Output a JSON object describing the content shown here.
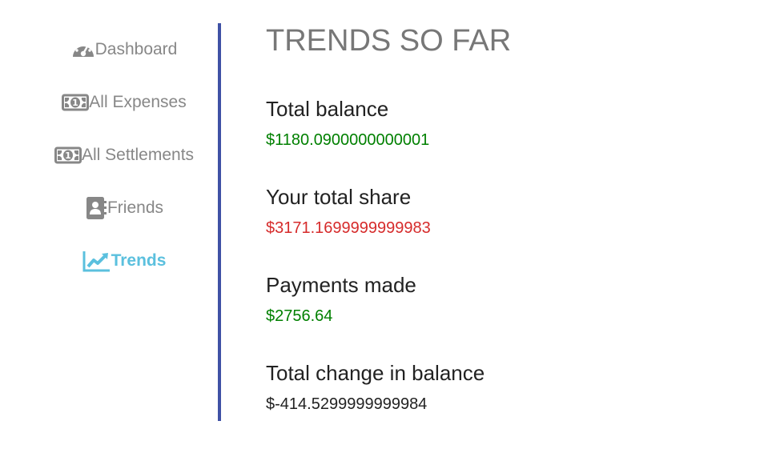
{
  "sidebar": {
    "items": [
      {
        "label": "Dashboard",
        "icon": "dashboard-icon"
      },
      {
        "label": "All Expenses",
        "icon": "money-bill-icon"
      },
      {
        "label": "All Settlements",
        "icon": "money-bill-icon"
      },
      {
        "label": "Friends",
        "icon": "address-book-icon"
      },
      {
        "label": "Trends",
        "icon": "chart-line-icon",
        "active": true
      }
    ]
  },
  "main": {
    "title": "TRENDS SO FAR",
    "stats": [
      {
        "label": "Total balance",
        "value": "$1180.0900000000001",
        "color": "#008000"
      },
      {
        "label": "Your total share",
        "value": "$3171.1699999999983",
        "color": "#d62b2b"
      },
      {
        "label": "Payments made",
        "value": "$2756.64",
        "color": "#008000"
      },
      {
        "label": "Total change in balance",
        "value": "$-414.5299999999984",
        "color": "#222222"
      }
    ]
  },
  "colors": {
    "accent": "#5bc0de",
    "divider": "#3f51a5",
    "muted": "#878787"
  }
}
